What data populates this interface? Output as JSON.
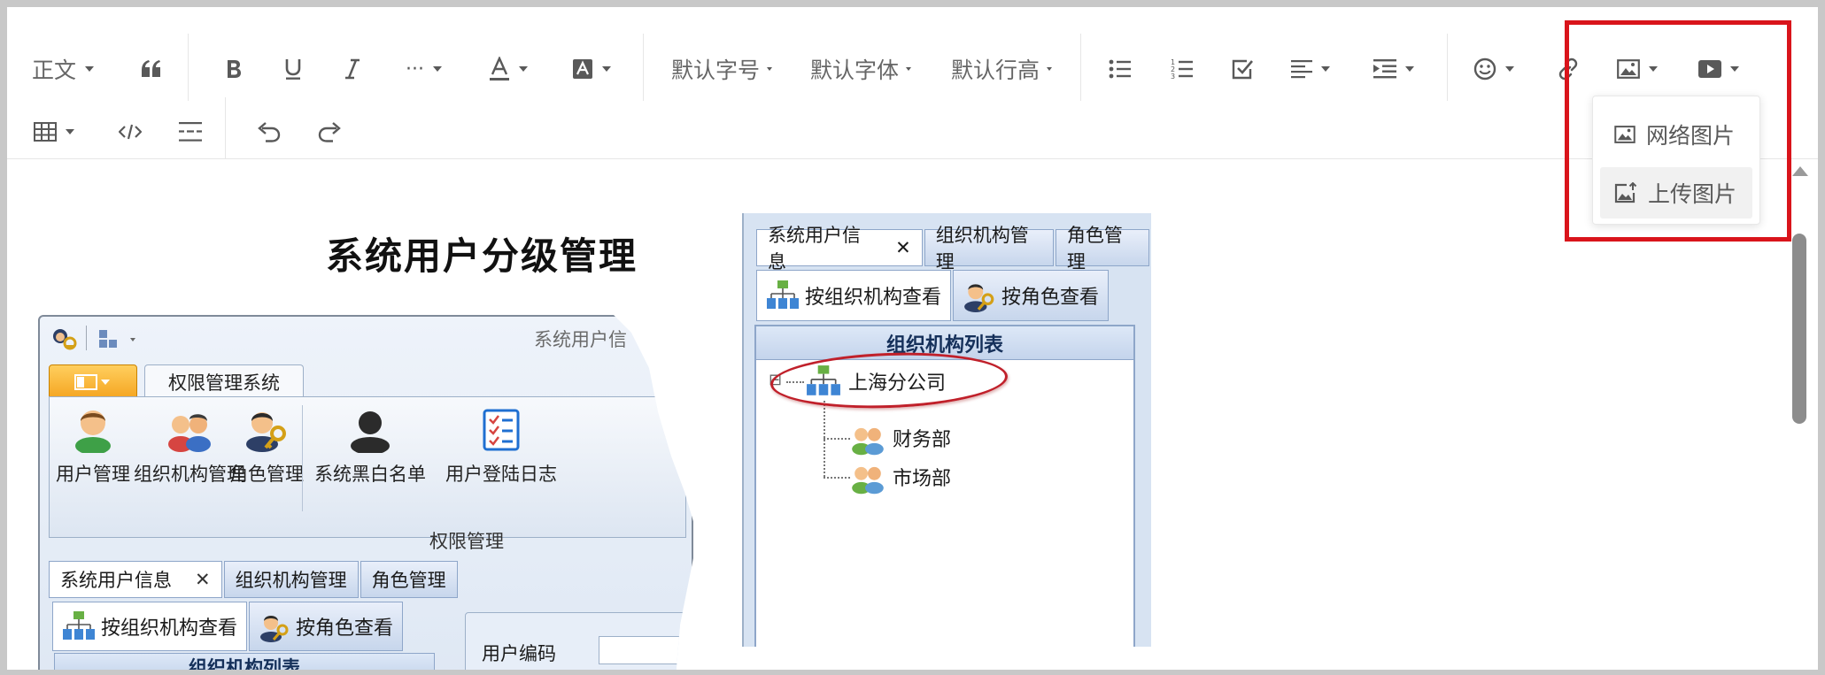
{
  "toolbar": {
    "row1": {
      "paragraph_style": "正文",
      "font_size": "默认字号",
      "font_family": "默认字体",
      "line_height": "默认行高"
    },
    "more_symbol": "···",
    "icons": [
      "quote-icon",
      "bold-icon",
      "underline-icon",
      "italic-icon",
      "more-icon",
      "font-color-icon",
      "bg-color-icon",
      "bulleted-list-icon",
      "numbered-list-icon",
      "todo-icon",
      "align-icon",
      "indent-icon",
      "emoji-icon",
      "link-icon",
      "image-icon",
      "video-icon",
      "table-icon",
      "code-icon",
      "divider-icon",
      "undo-icon",
      "redo-icon"
    ]
  },
  "image_menu": {
    "items": [
      {
        "label": "网络图片",
        "icon": "image-icon"
      },
      {
        "label": "上传图片",
        "icon": "upload-image-icon"
      }
    ],
    "highlight_color": "#d9141b"
  },
  "content": {
    "title": "系统用户分级管理",
    "left_screenshot": {
      "window_title": "系统用户信",
      "ribbon_tab": "权限管理系统",
      "buttons": [
        "用户管理",
        "组织机构管理",
        "角色管理",
        "系统黑白名单",
        "用户登陆日志"
      ],
      "group_label": "权限管理",
      "tabs": [
        "系统用户信息",
        "组织机构管理",
        "角色管理"
      ],
      "close_mark": "✕",
      "subtabs": [
        "按组织机构查看",
        "按角色查看"
      ],
      "org_list_header": "组织机构列表",
      "form_label": "用户编码"
    },
    "right_screenshot": {
      "tabs": [
        "系统用户信息",
        "组织机构管理",
        "角色管理"
      ],
      "close_mark": "✕",
      "subtabs": [
        "按组织机构查看",
        "按角色查看"
      ],
      "panel_header": "组织机构列表",
      "tree": {
        "root": "上海分公司",
        "children": [
          "财务部",
          "市场部"
        ],
        "expander": "⊟"
      },
      "circle_color": "#c0202a"
    }
  }
}
